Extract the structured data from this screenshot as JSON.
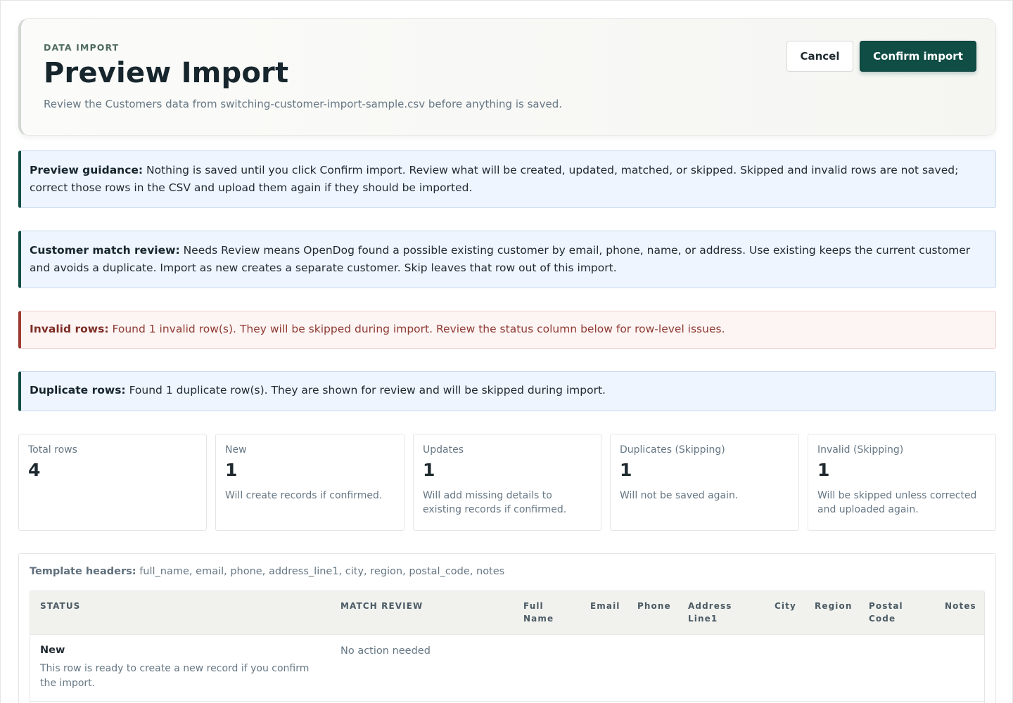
{
  "header": {
    "eyebrow": "DATA IMPORT",
    "title": "Preview Import",
    "subtitle": "Review the Customers data from switching-customer-import-sample.csv before anything is saved.",
    "cancel_label": "Cancel",
    "confirm_label": "Confirm import"
  },
  "notices": {
    "guidance": {
      "label": "Preview guidance:",
      "text": "Nothing is saved until you click Confirm import. Review what will be created, updated, matched, or skipped. Skipped and invalid rows are not saved; correct those rows in the CSV and upload them again if they should be imported."
    },
    "match_review": {
      "label": "Customer match review:",
      "text": "Needs Review means OpenDog found a possible existing customer by email, phone, name, or address. Use existing keeps the current customer and avoids a duplicate. Import as new creates a separate customer. Skip leaves that row out of this import."
    },
    "invalid": {
      "label": "Invalid rows:",
      "text": "Found 1 invalid row(s). They will be skipped during import. Review the status column below for row-level issues."
    },
    "duplicates": {
      "label": "Duplicate rows:",
      "text": "Found 1 duplicate row(s). They are shown for review and will be skipped during import."
    }
  },
  "stats": [
    {
      "label": "Total rows",
      "value": "4",
      "desc": ""
    },
    {
      "label": "New",
      "value": "1",
      "desc": "Will create records if confirmed."
    },
    {
      "label": "Updates",
      "value": "1",
      "desc": "Will add missing details to existing records if confirmed."
    },
    {
      "label": "Duplicates (Skipping)",
      "value": "1",
      "desc": "Will not be saved again."
    },
    {
      "label": "Invalid (Skipping)",
      "value": "1",
      "desc": "Will be skipped unless corrected and uploaded again."
    }
  ],
  "template": {
    "label": "Template headers:",
    "headers": "full_name, email, phone, address_line1, city, region, postal_code, notes"
  },
  "table": {
    "columns": {
      "status": "STATUS",
      "match_review": "MATCH REVIEW",
      "full_name": "Full Name",
      "email": "Email",
      "phone": "Phone",
      "address_line1": "Address Line1",
      "city": "City",
      "region": "Region",
      "postal_code": "Postal Code",
      "notes": "Notes"
    },
    "rows": [
      {
        "status": "New",
        "status_desc": "This row is ready to create a new record if you confirm the import.",
        "match_review": "No action needed"
      }
    ]
  }
}
